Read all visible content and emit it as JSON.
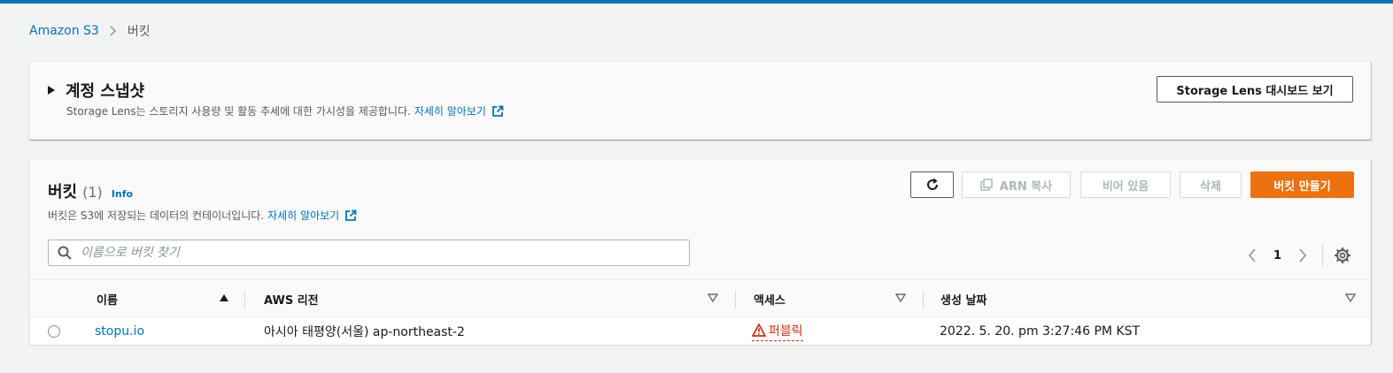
{
  "colors": {
    "accent": "#0073bb",
    "primary_button": "#ec7211",
    "warning": "#d13212"
  },
  "breadcrumb": {
    "root": "Amazon S3",
    "current": "버킷"
  },
  "snapshot": {
    "title": "계정 스냅샷",
    "description": "Storage Lens는 스토리지 사용량 및 활동 추세에 대한 가시성을 제공합니다.",
    "learn_more": "자세히 알아보기",
    "lens_button": "Storage Lens 대시보드 보기"
  },
  "buckets": {
    "title": "버킷",
    "count": "(1)",
    "info": "Info",
    "description": "버킷은 S3에 저장되는 데이터의 컨테이너입니다.",
    "learn_more": "자세히 알아보기",
    "buttons": {
      "copy_arn": "ARN 복사",
      "empty": "비어 있음",
      "delete": "삭제",
      "create": "버킷 만들기"
    },
    "search_placeholder": "이름으로 버킷 찾기",
    "page": "1",
    "columns": [
      "이름",
      "AWS 리전",
      "액세스",
      "생성 날짜"
    ],
    "rows": [
      {
        "name": "stopu.io",
        "region": "아시아 태평양(서울) ap-northeast-2",
        "access": "퍼블릭",
        "created": "2022. 5. 20. pm 3:27:46 PM KST"
      }
    ]
  }
}
